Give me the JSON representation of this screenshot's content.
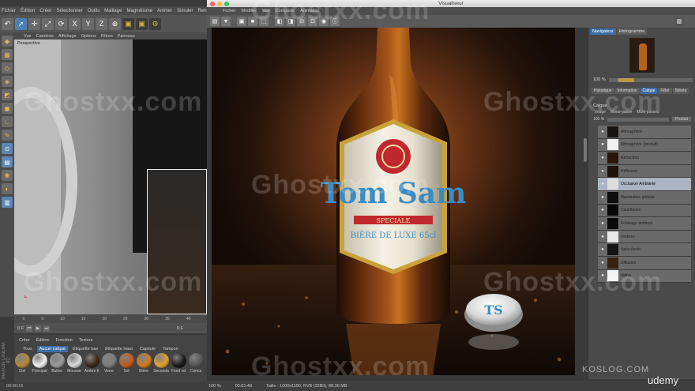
{
  "c4d": {
    "menu": [
      "Fichier",
      "Édition",
      "Créer",
      "Sélectionner",
      "Outils",
      "Maillage",
      "Magnétisme",
      "Animer",
      "Simuler",
      "Rendu",
      "Sculp"
    ],
    "axes": [
      "X",
      "Y",
      "Z"
    ],
    "viewport_menu": [
      "Vue",
      "Caméras",
      "Affichage",
      "Options",
      "Filtres",
      "Panneau"
    ],
    "viewport_label": "Perspective",
    "timeline_ticks": [
      "0",
      "5",
      "10",
      "15",
      "20",
      "25",
      "30",
      "35",
      "40"
    ],
    "timeline_start": "0 F",
    "timeline_end": "0 F",
    "material_menu": [
      "Créer",
      "Édition",
      "Fonction",
      "Texture"
    ],
    "material_filters": [
      "Tous",
      "Aucun calque",
      "Étiquette bas",
      "Étiquette Haut",
      "Capsule",
      "Tampon"
    ],
    "materials": [
      {
        "name": "Ciel",
        "color": "#b58a3a"
      },
      {
        "name": "Principal",
        "color": "#f2f2f2"
      },
      {
        "name": "Bulles",
        "color": "#9a9a9a"
      },
      {
        "name": "Mousse",
        "color": "#d8d8d8"
      },
      {
        "name": "Ambre fl",
        "color": "#3b2818"
      },
      {
        "name": "Verre",
        "color": "#7c7c7c"
      },
      {
        "name": "Sol",
        "color": "#c45a1a"
      },
      {
        "name": "Bière",
        "color": "#d07a1e"
      },
      {
        "name": "Seconda",
        "color": "#e0a030"
      },
      {
        "name": "Fond rel",
        "color": "#1a1a1a"
      },
      {
        "name": "Conca",
        "color": "#555555"
      }
    ],
    "status_time": "00:00:15",
    "brand": "MAXON CINEMA 4D"
  },
  "visualiseur": {
    "title": "Visualiseur",
    "menu": [
      "Fichier",
      "Modifier",
      "Vue",
      "Comparer",
      "Animation"
    ],
    "status": {
      "zoom": "100 %",
      "time": "00:01:49",
      "size": "Taille : 1000x1150, RVB (32Bit), 88.36 MB"
    }
  },
  "label_art": {
    "brand": "Tom Sam",
    "ribbon": "SPECIALE",
    "subtitle": "BIÈRE DE LUXE 65cl",
    "cap": "TS"
  },
  "right_panel": {
    "tabs": [
      "Navigateur",
      "Histogramme"
    ],
    "zoom": "100 %",
    "tabs2": [
      "Historique",
      "Information",
      "Calque",
      "Filtre",
      "Stéréo"
    ],
    "active_tab2": "Calque",
    "section": "Calque",
    "modes": [
      "Image",
      "Mono-passe",
      "Multi-passes"
    ],
    "opacity": "100 %",
    "blend": "Produit",
    "layers": [
      {
        "name": "Atmosphère",
        "thumb": "#1a1410"
      },
      {
        "name": "Atmosphère (produit)",
        "thumb": "#f0f0f0"
      },
      {
        "name": "Réfraction",
        "thumb": "#2a1608"
      },
      {
        "name": "Réflexion",
        "thumb": "#1e140c"
      },
      {
        "name": "Occlusion Ambiante",
        "thumb": "#dcdcdc"
      },
      {
        "name": "Illumination globale",
        "thumb": "#0d0d0d"
      },
      {
        "name": "Caustiques",
        "thumb": "#080808"
      },
      {
        "name": "Éclairage ambiant",
        "thumb": "#0a0a0a"
      },
      {
        "name": "Ombres",
        "thumb": "#e8e8e8"
      },
      {
        "name": "Spécularité",
        "thumb": "#151515"
      },
      {
        "name": "Diffusion",
        "thumb": "#3a200f"
      },
      {
        "name": "Alpha",
        "thumb": "#f5f5f5"
      }
    ],
    "active_layer": "Occlusion Ambiante"
  },
  "overlay": {
    "watermark": "Ghostxx.com",
    "koslog": "KOSLOG.COM",
    "udemy": "udemy"
  }
}
